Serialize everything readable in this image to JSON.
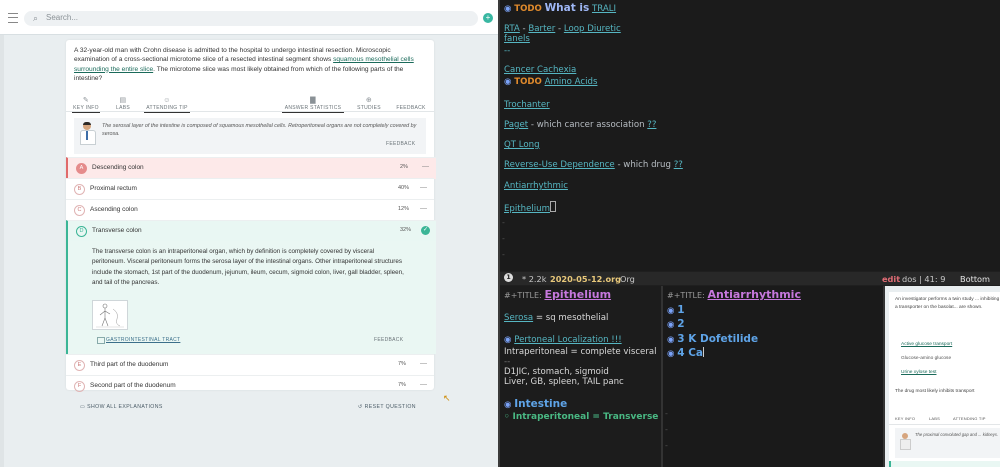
{
  "qbank": {
    "search": {
      "icon": "search-icon",
      "placeholder": "Search..."
    },
    "stem": {
      "before": "A 32-year-old man with Crohn disease is admitted to the hospital to undergo intestinal resection. Microscopic examination of a cross-sectional microtome slice of a resected intestinal segment shows ",
      "highlight": "squamous mesothelial cells surrounding the entire slice",
      "after": ". The microtome slice was most likely obtained from which of the following parts of the intestine?"
    },
    "tabs": [
      {
        "label": "KEY INFO",
        "icon": "pencil-icon"
      },
      {
        "label": "LABS",
        "icon": "labs-icon"
      },
      {
        "label": "ATTENDING TIP",
        "icon": "doctor-icon"
      },
      {
        "label": "ANSWER STATISTICS",
        "icon": "bar-chart-icon"
      },
      {
        "label": "STUDIES",
        "icon": "plus-circle-icon"
      },
      {
        "label": "FEEDBACK",
        "icon": "feedback-icon"
      }
    ],
    "tip": {
      "text": "The serosal layer of the intestine is composed of squamous mesothelial cells. Retroperitoneal organs are not completely covered by serosa.",
      "feedback": "FEEDBACK"
    },
    "choices": [
      {
        "letter": "A",
        "label": "Descending colon",
        "pct": "2%",
        "state": "wrong"
      },
      {
        "letter": "B",
        "label": "Proximal rectum",
        "pct": "40%",
        "state": "normal"
      },
      {
        "letter": "C",
        "label": "Ascending colon",
        "pct": "12%",
        "state": "normal"
      },
      {
        "letter": "D",
        "label": "Transverse colon",
        "pct": "32%",
        "state": "correct"
      },
      {
        "letter": "E",
        "label": "Third part of the duodenum",
        "pct": "7%",
        "state": "normal"
      },
      {
        "letter": "F",
        "label": "Second part of the duodenum",
        "pct": "7%",
        "state": "normal"
      }
    ],
    "explanation": {
      "text": "The transverse colon is an intraperitoneal organ, which by definition is completely covered by visceral peritoneum. Visceral peritoneum forms the serosa layer of the intestinal organs. Other intraperitoneal structures include the stomach, 1st part of the duodenum, jejunum, ileum, cecum, sigmoid colon, liver, gall bladder, spleen, and tail of the pancreas.",
      "link": "GASTROINTESTINAL TRACT",
      "feedback": "FEEDBACK"
    },
    "bottom": {
      "show_all": "SHOW ALL EXPLANATIONS",
      "reset": "RESET QUESTION"
    },
    "colors": {
      "accent": "#39b7a2",
      "wrong": "#e06a6a",
      "correct": "#3bb596"
    }
  },
  "editor": {
    "top_lines": [
      {
        "kind": "heading",
        "todo": "TODO",
        "text": "What is",
        "link": "TRALI"
      },
      {
        "kind": "links",
        "parts": [
          "RTA",
          " - ",
          "Barter",
          " - ",
          "Loop Diuretic"
        ]
      },
      {
        "kind": "link",
        "text": "fanels"
      },
      {
        "kind": "plain",
        "text": "--"
      },
      {
        "kind": "link",
        "text": "Cancer Cachexia"
      },
      {
        "kind": "heading",
        "todo": "TODO",
        "link": "Amino Acids"
      },
      {
        "kind": "link",
        "text": "Trochanter"
      },
      {
        "kind": "mixed",
        "link": "Paget",
        "text": " - which cancer association ",
        "q": "??"
      },
      {
        "kind": "link",
        "text": "QT Long"
      },
      {
        "kind": "mixed",
        "link": "Reverse-Use Dependence",
        "text": " - which drug ",
        "q": "??"
      },
      {
        "kind": "link",
        "text": "Antiarrhythmic"
      },
      {
        "kind": "link",
        "text": "Epithelium"
      }
    ],
    "modeline": {
      "num": "1",
      "size": "* 2.2k",
      "file": "2020-05-12.org",
      "mode": "Org",
      "state": "edit",
      "pos": "dos | 41: 9",
      "where": "Bottom"
    },
    "left_buffer": {
      "title_key": "#+TITLE:",
      "title": "Epithelium",
      "line1_link": "Serosa",
      "line1_rest": " = sq mesothelial",
      "heading": "Pertoneal Localization !!!",
      "l2": "Intraperitoneal = complete visceral",
      "l3": "--",
      "l4": "D1JIC, stomach, sigmoid",
      "l5": "Liver, GB, spleen, TAIL panc",
      "h1": "Intestine",
      "h2": "Intraperitoneal = Transverse"
    },
    "mid_buffer": {
      "title_key": "#+TITLE:",
      "title": "Antiarrhythmic",
      "items": [
        "1",
        "2",
        "3 K Dofetilide",
        "4 Ca"
      ]
    },
    "right_card": {
      "stem": "An investigator performs a twin study ... inhibiting a transporter on the basolat... are shown.",
      "opt1": "Active glucose transport",
      "opt2": "Glucose-amino glucose",
      "opt3": "Urine xylose test",
      "q": "The drug most likely inhibits transport",
      "tabs": [
        "KEY INFO",
        "LABS",
        "ATTENDING TIP"
      ],
      "tip": "The proximal convoluted gap and ... kidneys."
    },
    "colors": {
      "todo": "#e08a2c",
      "link": "#56b6c2",
      "title": "#c678dd",
      "heading": "#5fa4e8",
      "sub": "#49b883"
    }
  }
}
